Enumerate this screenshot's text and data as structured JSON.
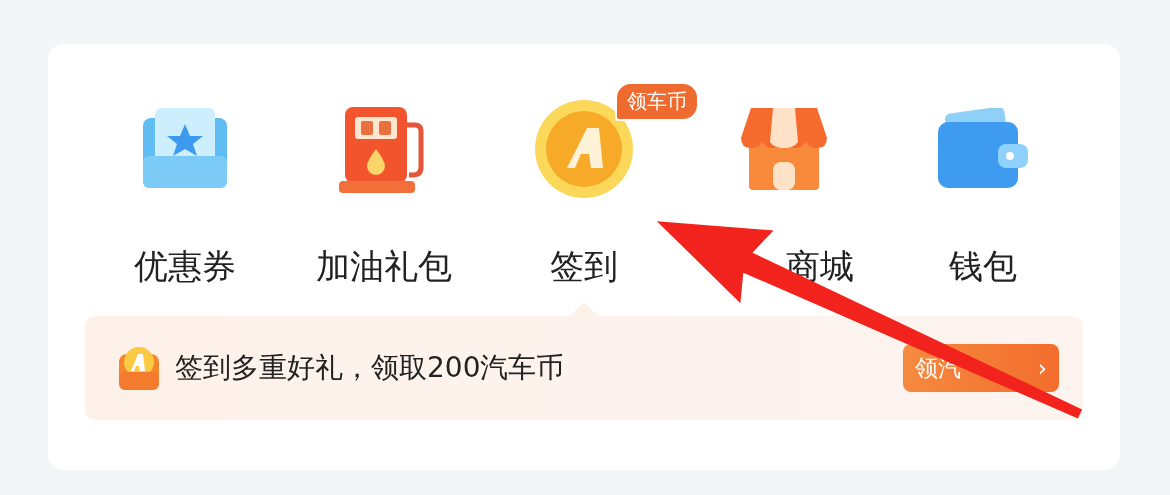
{
  "entries": [
    {
      "label": "优惠券",
      "selected": false
    },
    {
      "label": "加油礼包",
      "selected": false
    },
    {
      "label": "签到",
      "selected": true,
      "badge": "领车币"
    },
    {
      "label": "商城",
      "selected": false
    },
    {
      "label": "钱包",
      "selected": false
    }
  ],
  "banner": {
    "text": "签到多重好礼，领取200汽车币",
    "button": "领汽",
    "chevron": "›"
  }
}
